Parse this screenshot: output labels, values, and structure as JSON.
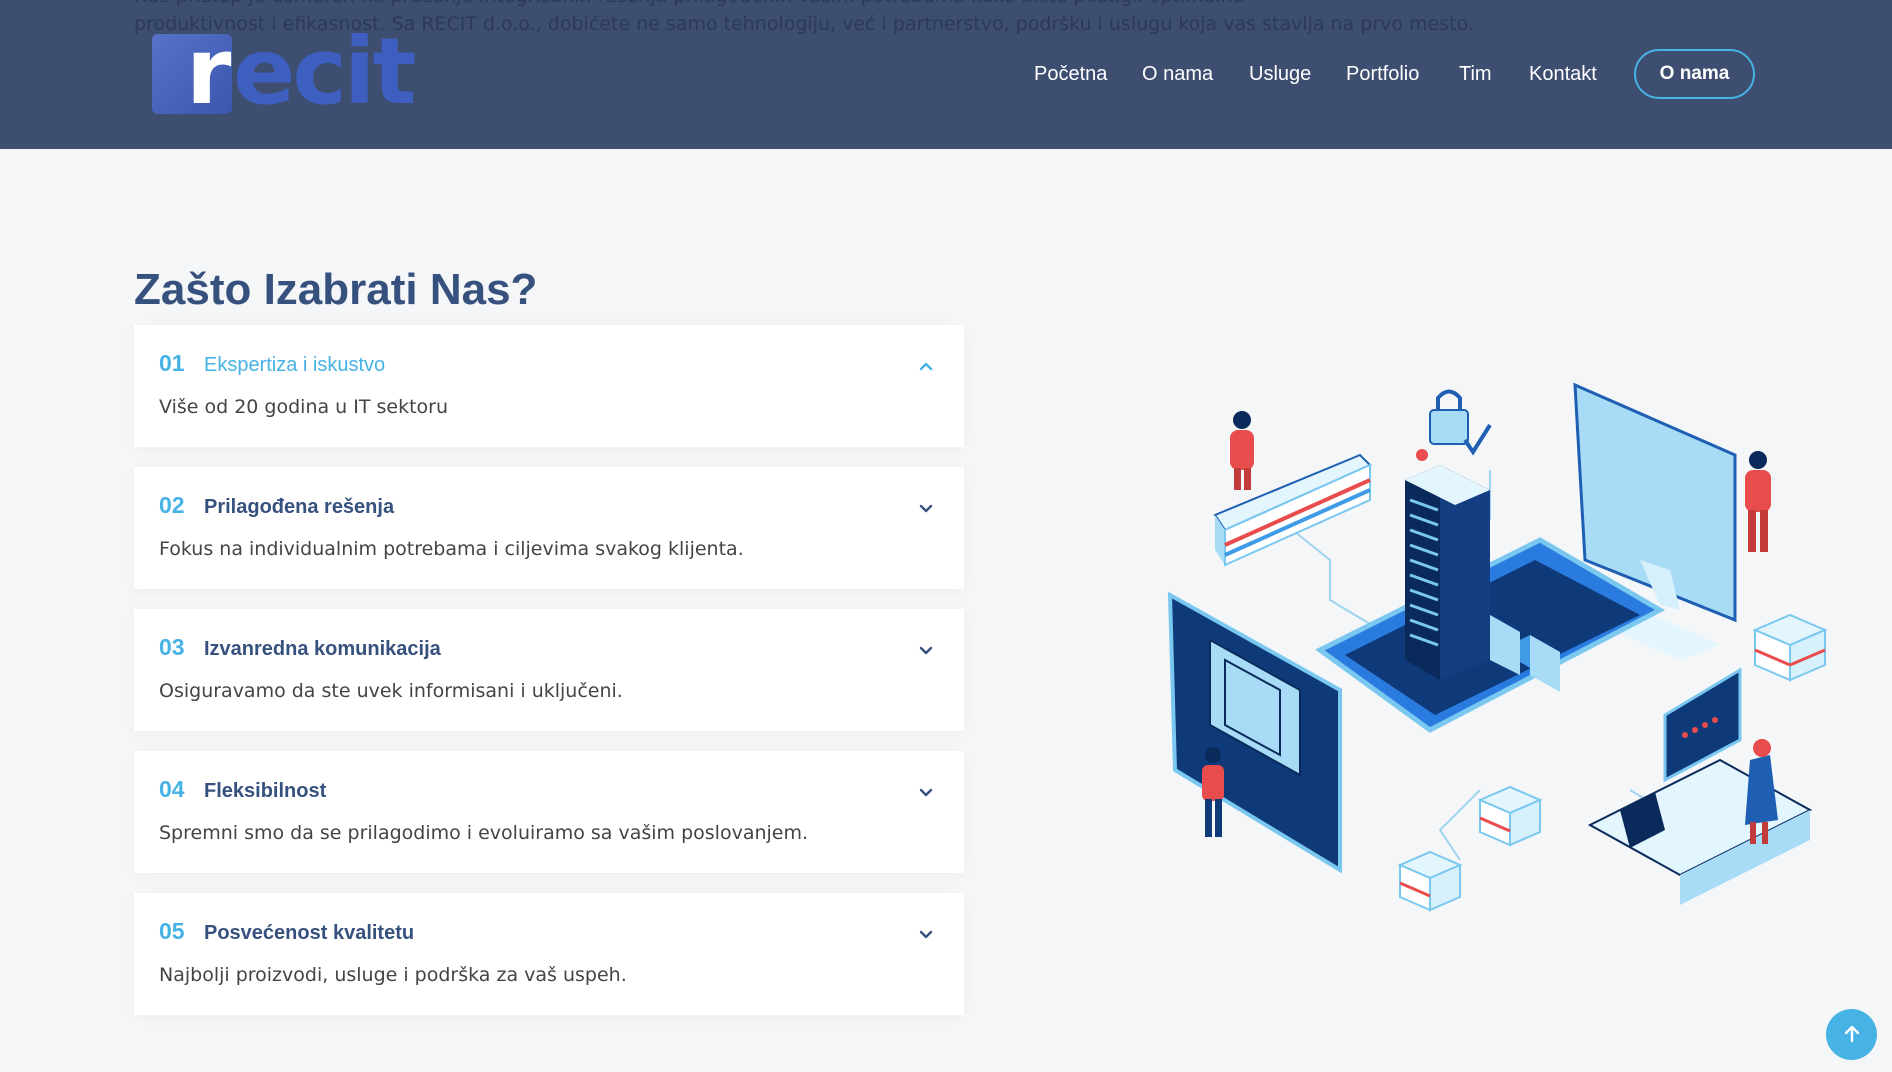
{
  "header": {
    "bleed_line_1": "Naš pristup je usmeren na pružanje integrisanih rešenja prilagođenih vašim potrebama kako biste postigli optimalnu",
    "bleed_line_2": "produktivnost i efikasnost. Sa RECIT d.o.o., dobićete ne samo tehnologiju, već i partnerstvo, podršku i uslugu koja vas stavlja na prvo mesto.",
    "logo_letter": "r",
    "logo_rest": "ecit",
    "nav": [
      "Početna",
      "O nama",
      "Usluge",
      "Portfolio",
      "Tim",
      "Kontakt"
    ],
    "cta_label": "O nama"
  },
  "section": {
    "title_light": "Zašto Izabrati ",
    "title_bold": "Nas?",
    "items": [
      {
        "num": "01",
        "question": "Ekspertiza i iskustvo",
        "answer": "Više od 20 godina u IT sektoru",
        "expanded": true
      },
      {
        "num": "02",
        "question": "Prilagođena rešenja",
        "answer": "Fokus na individualnim potrebama i ciljevima svakog klijenta.",
        "expanded": false
      },
      {
        "num": "03",
        "question": "Izvanredna komunikacija",
        "answer": "Osiguravamo da ste uvek informisani i uključeni.",
        "expanded": false
      },
      {
        "num": "04",
        "question": "Fleksibilnost",
        "answer": "Spremni smo da se prilagodimo i evoluiramo sa vašim poslovanjem.",
        "expanded": false
      },
      {
        "num": "05",
        "question": "Posvećenost kvalitetu",
        "answer": "Najbolji proizvodi, usluge i podrška za vaš uspeh.",
        "expanded": false
      }
    ]
  },
  "colors": {
    "header_bg": "#3d4e71",
    "accent": "#47b2e4",
    "heading": "#37517e",
    "page_bg": "#f5f6f8"
  },
  "icons": {
    "faq_toggle_open": "chevron-up-icon",
    "faq_toggle_closed": "chevron-down-icon",
    "scroll_top": "arrow-up-icon"
  }
}
